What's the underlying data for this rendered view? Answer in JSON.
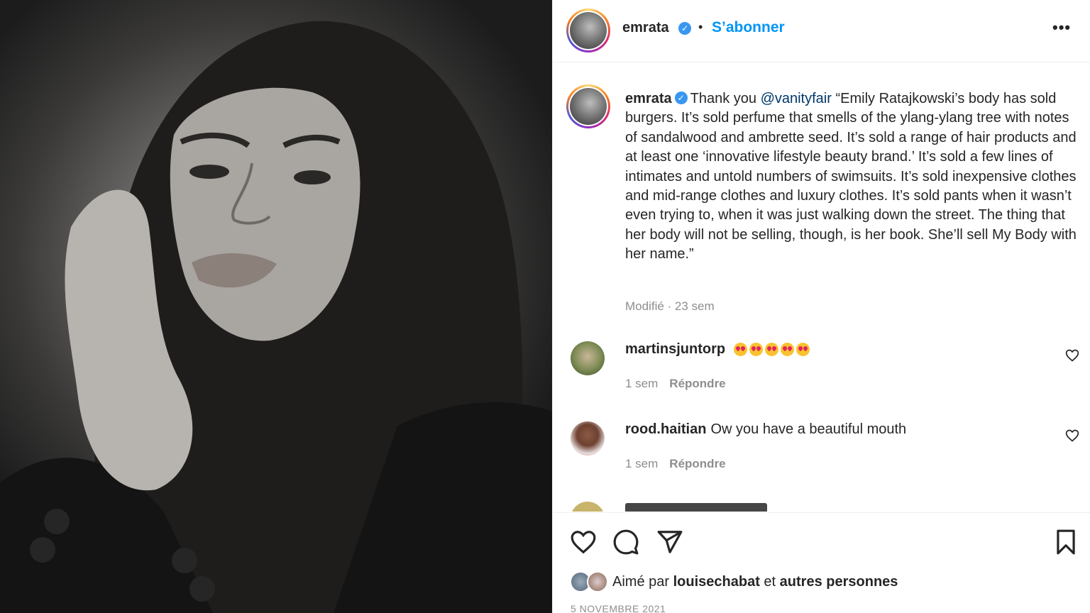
{
  "post_image": {
    "alt_icon": "portrait-photo"
  },
  "header": {
    "username": "emrata",
    "verified_icon": "verified-badge-icon",
    "separator": "•",
    "follow_label": "S’abonner",
    "more_icon": "more-options-icon",
    "more_glyph": "•••"
  },
  "caption": {
    "username": "emrata",
    "intro": "Thank you",
    "mention": "@vanityfair",
    "text": "“Emily Ratajkowski’s body has sold burgers. It’s sold perfume that smells of the ylang-ylang tree with notes of sandalwood and ambrette seed. It’s sold a range of hair products and at least one ‘innovative lifestyle beauty brand.’ It’s sold a few lines of intimates and untold numbers of swimsuits. It’s sold inexpensive clothes and mid-range clothes and luxury clothes. It’s sold pants when it wasn’t even trying to, when it was just walking down the street. The thing that her body will not be selling, though, is her book. She’ll sell My Body with her name.”",
    "meta": "Modifié · 23 sem"
  },
  "comments": [
    {
      "username": "martinsjuntorp",
      "text": "",
      "emoji_count": 5,
      "time": "1 sem",
      "reply": "Répondre"
    },
    {
      "username": "rood.haitian",
      "text": "Ow you have a beautiful mouth",
      "time": "1 sem",
      "reply": "Répondre"
    }
  ],
  "actions": {
    "like_icon": "heart-icon",
    "comment_icon": "comment-icon",
    "share_icon": "paper-plane-icon",
    "save_icon": "bookmark-icon"
  },
  "likes": {
    "prefix": "Aimé par",
    "user": "louisechabat",
    "connector": "et",
    "others": "autres personnes"
  },
  "date": "5 NOVEMBRE 2021",
  "colors": {
    "accent": "#0095f6",
    "mention": "#00376b",
    "muted": "#8e8e8e",
    "verified": "#3897f0"
  }
}
